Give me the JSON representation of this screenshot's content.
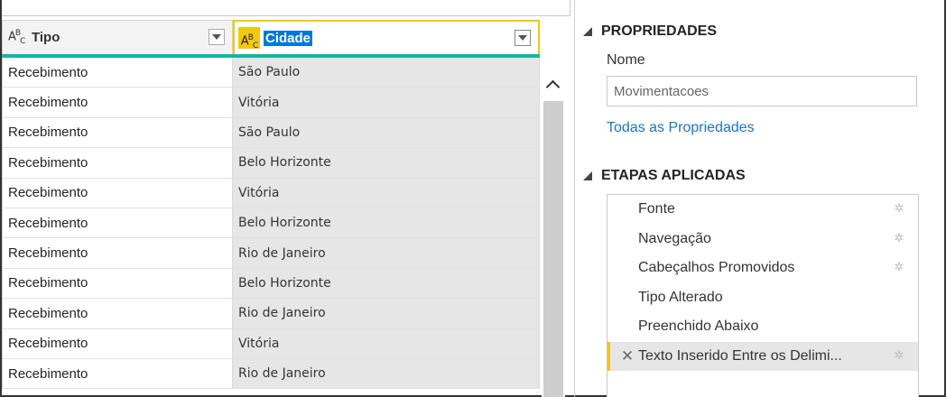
{
  "columns": {
    "tipo": {
      "type_icon": "ABC",
      "label": "Tipo"
    },
    "cidade": {
      "type_icon": "ABC",
      "label": "Cidade"
    }
  },
  "rows": [
    {
      "tipo": "Recebimento",
      "cidade": "São Paulo"
    },
    {
      "tipo": "Recebimento",
      "cidade": "Vitória"
    },
    {
      "tipo": "Recebimento",
      "cidade": "São Paulo"
    },
    {
      "tipo": "Recebimento",
      "cidade": "Belo Horizonte"
    },
    {
      "tipo": "Recebimento",
      "cidade": "Vitória"
    },
    {
      "tipo": "Recebimento",
      "cidade": "Belo Horizonte"
    },
    {
      "tipo": "Recebimento",
      "cidade": "Rio de Janeiro"
    },
    {
      "tipo": "Recebimento",
      "cidade": "Belo Horizonte"
    },
    {
      "tipo": "Recebimento",
      "cidade": "Rio de Janeiro"
    },
    {
      "tipo": "Recebimento",
      "cidade": "Vitória"
    },
    {
      "tipo": "Recebimento",
      "cidade": "Rio de Janeiro"
    }
  ],
  "panel": {
    "properties_title": "PROPRIEDADES",
    "name_label": "Nome",
    "name_value": "Movimentacoes",
    "all_properties_link": "Todas as Propriedades",
    "steps_title": "ETAPAS APLICADAS",
    "steps": [
      {
        "label": "Fonte",
        "has_gear": true,
        "active": false
      },
      {
        "label": "Navegação",
        "has_gear": true,
        "active": false
      },
      {
        "label": "Cabeçalhos Promovidos",
        "has_gear": true,
        "active": false
      },
      {
        "label": "Tipo Alterado",
        "has_gear": false,
        "active": false
      },
      {
        "label": "Preenchido Abaixo",
        "has_gear": false,
        "active": false
      },
      {
        "label": "Texto Inserido Entre os Delimi...",
        "has_gear": true,
        "active": true
      }
    ]
  },
  "colors": {
    "selected_accent": "#f2c811",
    "selected_header_text_bg": "#0078d7",
    "column_quality_bar": "#13b5a4",
    "link": "#1a73c8"
  }
}
